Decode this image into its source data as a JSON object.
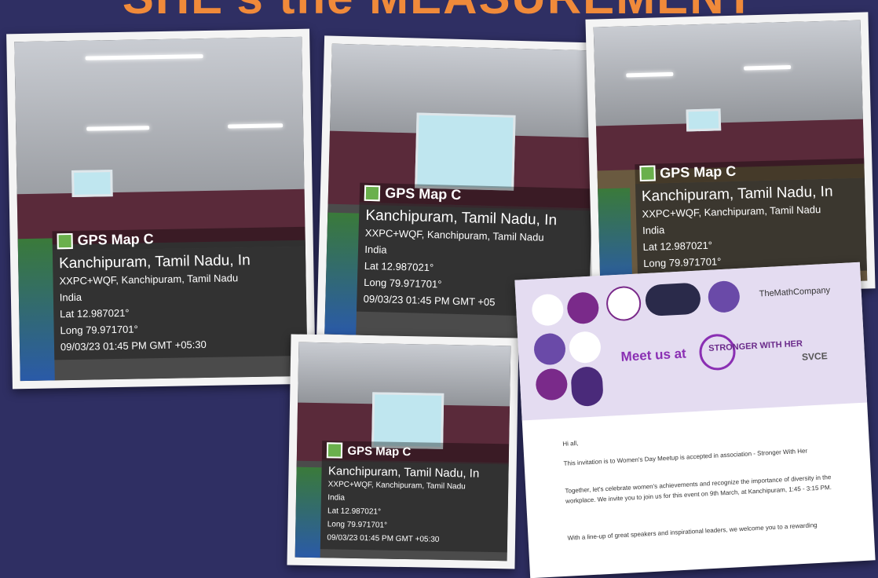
{
  "banner": {
    "text": "SHE's the MEASUREMENT"
  },
  "photos": [
    {
      "brand": "GPS Map C",
      "location": "Kanchipuram, Tamil Nadu, In",
      "address": "XXPC+WQF, Kanchipuram, Tamil Nadu",
      "country": "India",
      "lat": "Lat 12.987021°",
      "long": "Long 79.971701°",
      "timestamp": "09/03/23 01:45 PM GMT +05:30"
    },
    {
      "brand": "GPS Map C",
      "location": "Kanchipuram, Tamil Nadu, In",
      "address": "XXPC+WQF, Kanchipuram, Tamil Nadu",
      "country": "India",
      "lat": "Lat 12.987021°",
      "long": "Long 79.971701°",
      "timestamp": "09/03/23 01:45 PM GMT +05"
    },
    {
      "brand": "GPS Map C",
      "location": "Kanchipuram, Tamil Nadu, In",
      "address": "XXPC+WQF, Kanchipuram, Tamil Nadu",
      "country": "India",
      "lat": "Lat 12.987021°",
      "long": "Long 79.971701°",
      "timestamp": ""
    },
    {
      "brand": "GPS Map C",
      "location": "Kanchipuram, Tamil Nadu, In",
      "address": "XXPC+WQF, Kanchipuram, Tamil Nadu",
      "country": "India",
      "lat": "Lat 12.987021°",
      "long": "Long 79.971701°",
      "timestamp": "09/03/23 01:45 PM GMT +05:30"
    }
  ],
  "letter": {
    "company": "TheMathCompany",
    "meet": "Meet us at",
    "stronger": "STRONGER WITH HER",
    "svce": "SVCE",
    "greeting": "Hi all,",
    "line1": "This invitation is to Women's Day Meetup is accepted in association - Stronger With Her",
    "line2": "Together, let's celebrate women's achievements and recognize the importance of diversity in the workplace. We invite you to join us for this event on 9th March, at Kanchipuram, 1:45 - 3:15 PM.",
    "line3": "With a line-up of great speakers and inspirational leaders, we welcome you to a rewarding"
  }
}
